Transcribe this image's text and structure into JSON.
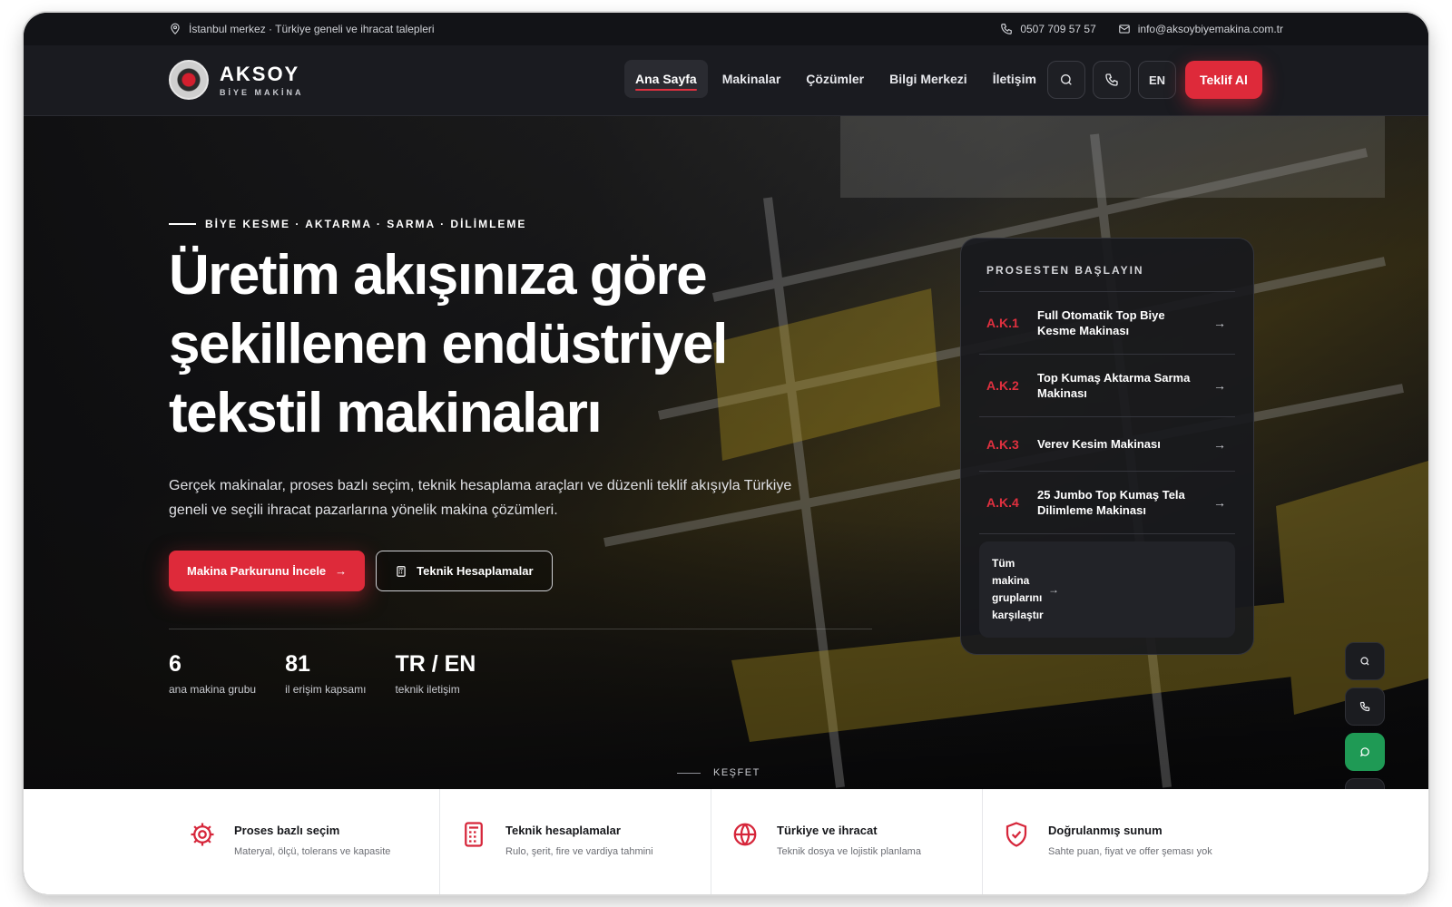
{
  "topbar": {
    "location": "İstanbul merkez · Türkiye geneli ve ihracat talepleri",
    "phone": "0507 709 57 57",
    "email": "info@aksoybiyemakina.com.tr"
  },
  "brand": {
    "name": "AKSOY",
    "tagline": "BİYE MAKİNA"
  },
  "nav": {
    "items": [
      {
        "label": "Ana Sayfa",
        "active": true
      },
      {
        "label": "Makinalar"
      },
      {
        "label": "Çözümler"
      },
      {
        "label": "Bilgi Merkezi"
      },
      {
        "label": "İletişim"
      }
    ],
    "lang": "EN",
    "cta": "Teklif Al"
  },
  "hero": {
    "eyebrow": "BİYE KESME · AKTARMA · SARMA · DİLİMLEME",
    "title": "Üretim akışınıza göre şekillenen endüstriyel tekstil makinaları",
    "subtitle": "Gerçek makinalar, proses bazlı seçim, teknik hesaplama araçları ve düzenli teklif akışıyla Türkiye geneli ve seçili ihracat pazarlarına yönelik makina çözümleri.",
    "primary_btn": "Makina Parkurunu İncele",
    "secondary_btn": "Teknik Hesaplamalar",
    "stats": [
      {
        "value": "6",
        "label": "ana makina grubu"
      },
      {
        "value": "81",
        "label": "il erişim kapsamı"
      },
      {
        "value": "TR / EN",
        "label": "teknik iletişim"
      }
    ],
    "explore": "KEŞFET"
  },
  "panel": {
    "title": "PROSESTEN BAŞLAYIN",
    "items": [
      {
        "code": "A.K.1",
        "name": "Full Otomatik Top Biye Kesme Makinası"
      },
      {
        "code": "A.K.2",
        "name": "Top Kumaş Aktarma Sarma Makinası"
      },
      {
        "code": "A.K.3",
        "name": "Verev Kesim Makinası"
      },
      {
        "code": "A.K.4",
        "name": "25 Jumbo Top Kumaş Tela Dilimleme Makinası"
      }
    ],
    "all_link": "Tüm makina gruplarını karşılaştır"
  },
  "features": [
    {
      "icon": "gear-icon",
      "title": "Proses bazlı seçim",
      "desc": "Materyal, ölçü, tolerans ve kapasite"
    },
    {
      "icon": "calculator-icon",
      "title": "Teknik hesaplamalar",
      "desc": "Rulo, şerit, fire ve vardiya tahmini"
    },
    {
      "icon": "globe-icon",
      "title": "Türkiye ve ihracat",
      "desc": "Teknik dosya ve lojistik planlama"
    },
    {
      "icon": "shield-check-icon",
      "title": "Doğrulanmış sunum",
      "desc": "Sahte puan, fiyat ve offer şeması yok"
    }
  ],
  "colors": {
    "accent": "#de2a3a",
    "whatsapp": "#1f9a55",
    "dark": "#1a1b20"
  }
}
